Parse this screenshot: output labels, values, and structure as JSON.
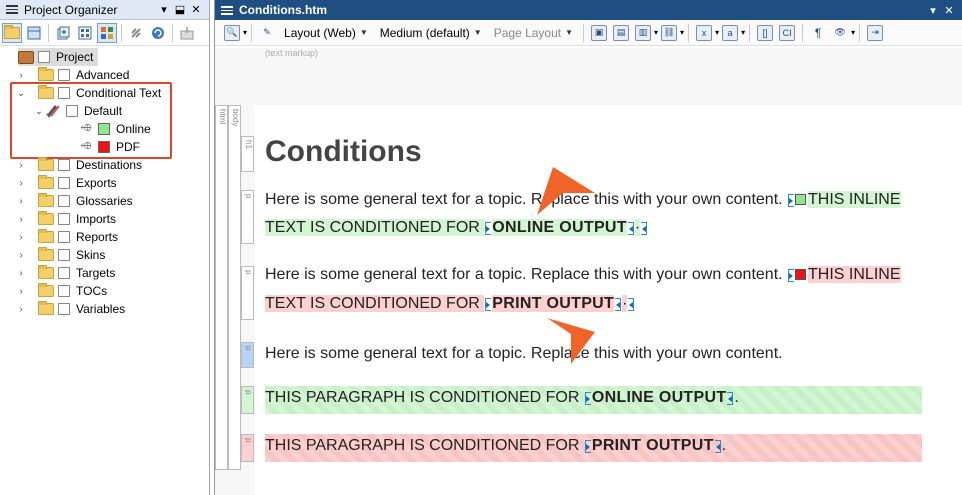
{
  "left_panel": {
    "title": "Project Organizer",
    "pin_glyph": "⬓",
    "close_glyph": "✕",
    "tree": {
      "project_label": "Project",
      "items": [
        {
          "label": "Advanced",
          "expanded": false
        },
        {
          "label": "Conditional Text",
          "expanded": true
        },
        {
          "label": "Destinations",
          "expanded": false
        },
        {
          "label": "Exports",
          "expanded": false
        },
        {
          "label": "Glossaries",
          "expanded": false
        },
        {
          "label": "Imports",
          "expanded": false
        },
        {
          "label": "Reports",
          "expanded": false
        },
        {
          "label": "Skins",
          "expanded": false
        },
        {
          "label": "Targets",
          "expanded": false
        },
        {
          "label": "TOCs",
          "expanded": false
        },
        {
          "label": "Variables",
          "expanded": false
        }
      ],
      "condition_set": "Default",
      "conditions": [
        {
          "label": "Online",
          "color": "#8ee88e"
        },
        {
          "label": "PDF",
          "color": "#ee1111"
        }
      ]
    }
  },
  "editor": {
    "title": "Conditions.htm",
    "toolbar": {
      "layout_label": "Layout (Web)",
      "medium_label": "Medium (default)",
      "page_layout_label": "Page Layout"
    },
    "markup_label": "(text markup)",
    "structure_labels": {
      "html": "html",
      "body": "body",
      "h1": "h1",
      "p": "p"
    },
    "document": {
      "heading": "Conditions",
      "p1_plain": "Here is some general text for a topic. Replace this with your own content. ",
      "p1_cond_a": "THIS INLINE",
      "p1_cond_b": "TEXT IS CONDITIONED FOR ",
      "p1_bold": "ONLINE OUTPUT",
      "p2_plain": "Here is some general text for a topic. Replace this with your own content. ",
      "p2_cond_a": "THIS INLINE",
      "p2_cond_b": "TEXT IS CONDITIONED FOR ",
      "p2_bold": "PRINT OUTPUT",
      "p3_plain": "Here is some general text for a topic. Replace this with your own content.",
      "p4_text": "THIS PARAGRAPH IS CONDITIONED FOR ",
      "p4_bold": "ONLINE OUTPUT",
      "p5_text": "THIS PARAGRAPH IS CONDITIONED FOR ",
      "p5_bold": "PRINT OUTPUT",
      "period": "."
    },
    "colors": {
      "online": "#d3f5d3",
      "print": "#ffd0d0",
      "callout_arrow": "#f0642a",
      "highlight_box": "#d9482b"
    }
  }
}
